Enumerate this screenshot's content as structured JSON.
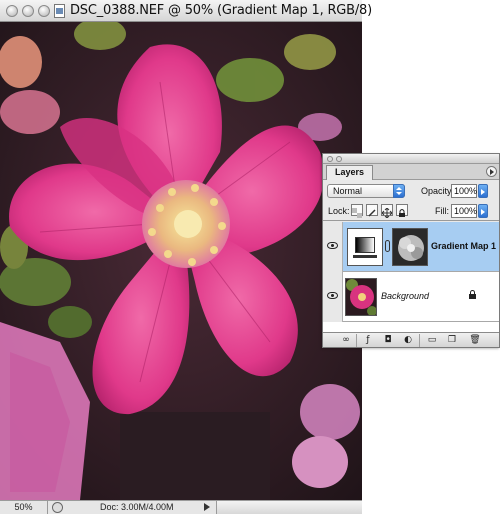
{
  "document": {
    "title": "DSC_0388.NEF @ 50% (Gradient Map 1, RGB/8)",
    "zoom": "50%",
    "doc_size": "Doc: 3.00M/4.00M"
  },
  "layers_panel": {
    "tab_label": "Layers",
    "blend_mode": "Normal",
    "opacity_label": "Opacity:",
    "opacity_value": "100%",
    "lock_label": "Lock:",
    "fill_label": "Fill:",
    "fill_value": "100%",
    "layers": [
      {
        "name": "Gradient Map 1",
        "selected": true,
        "visible": true
      },
      {
        "name": "Background",
        "selected": false,
        "visible": true,
        "locked": true
      }
    ]
  },
  "icons": [
    "window-close-icon",
    "window-minimize-icon",
    "window-zoom-icon",
    "document-icon",
    "eye-icon",
    "chain-link-icon",
    "lock-icon",
    "lock-transparent-pixels-icon",
    "lock-image-pixels-icon",
    "lock-position-icon",
    "link-layers-icon",
    "layer-style-icon",
    "layer-mask-icon",
    "adjustment-layer-icon",
    "new-group-icon",
    "new-layer-icon",
    "trash-icon",
    "panel-menu-icon"
  ],
  "colors": {
    "selected_layer": "#a7cdf2",
    "aqua_blue": "#2c6fd0",
    "flower_pink": "#e3418f"
  }
}
